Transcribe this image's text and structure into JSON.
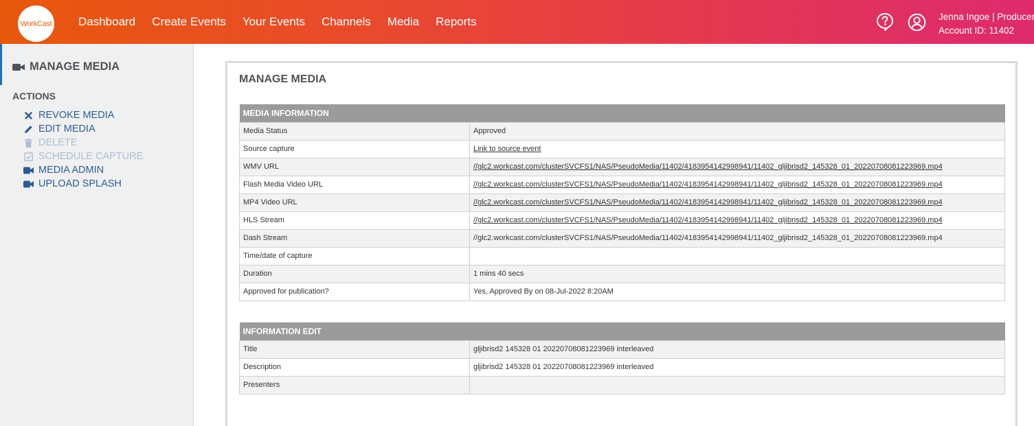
{
  "nav": {
    "logo": "WorkCast",
    "items": [
      "Dashboard",
      "Create Events",
      "Your Events",
      "Channels",
      "Media",
      "Reports"
    ],
    "user_name": "Jenna Ingoe",
    "separator": " | ",
    "user_role": "Producer",
    "account": "Account ID: 11402"
  },
  "sidebar": {
    "title": "MANAGE MEDIA",
    "actions_heading": "ACTIONS",
    "actions": [
      {
        "label": "REVOKE MEDIA",
        "icon": "x-icon",
        "enabled": true
      },
      {
        "label": "EDIT MEDIA",
        "icon": "pencil-icon",
        "enabled": true
      },
      {
        "label": "DELETE",
        "icon": "trash-icon",
        "enabled": false
      },
      {
        "label": "SCHEDULE CAPTURE",
        "icon": "calendar-check-icon",
        "enabled": false
      },
      {
        "label": "MEDIA ADMIN",
        "icon": "video-camera-icon",
        "enabled": true
      },
      {
        "label": "UPLOAD SPLASH",
        "icon": "video-camera-icon",
        "enabled": true
      }
    ]
  },
  "main": {
    "title": "MANAGE MEDIA",
    "media_information": {
      "heading": "MEDIA INFORMATION",
      "rows": [
        {
          "label": "Media Status",
          "value": "Approved",
          "link": false
        },
        {
          "label": "Source capture",
          "value": "Link to source event",
          "link": true
        },
        {
          "label": "WMV URL",
          "value": "//glc2.workcast.com/clusterSVCFS1/NAS/PseudoMedia/11402/4183954142998941/11402_gljibrisd2_145328_01_20220708081223969.mp4",
          "link": true
        },
        {
          "label": "Flash Media Video URL",
          "value": "//glc2.workcast.com/clusterSVCFS1/NAS/PseudoMedia/11402/4183954142998941/11402_gljibrisd2_145328_01_20220708081223969.mp4",
          "link": true
        },
        {
          "label": "MP4 Video URL",
          "value": "//glc2.workcast.com/clusterSVCFS1/NAS/PseudoMedia/11402/4183954142998941/11402_gljibrisd2_145328_01_20220708081223969.mp4",
          "link": true
        },
        {
          "label": "HLS Stream",
          "value": "//glc2.workcast.com/clusterSVCFS1/NAS/PseudoMedia/11402/4183954142998941/11402_gljibrisd2_145328_01_20220708081223969.mp4",
          "link": true
        },
        {
          "label": "Dash Stream",
          "value": "//glc2.workcast.com/clusterSVCFS1/NAS/PseudoMedia/11402/4183954142998941/11402_gljibrisd2_145328_01_20220708081223969.mp4",
          "link": false
        },
        {
          "label": "Time/date of capture",
          "value": "",
          "link": false
        },
        {
          "label": "Duration",
          "value": "1 mins 40 secs",
          "link": false
        },
        {
          "label": "Approved for publication?",
          "value": "Yes, Approved By on 08-Jul-2022 8:20AM",
          "link": false
        }
      ]
    },
    "information_edit": {
      "heading": "INFORMATION EDIT",
      "rows": [
        {
          "label": "Title",
          "value": "gljibrisd2 145328 01 20220708081223969 interleaved",
          "link": false
        },
        {
          "label": "Description",
          "value": "gljibrisd2 145328 01 20220708081223969 interleaved",
          "link": false
        },
        {
          "label": "Presenters",
          "value": "",
          "link": false
        }
      ]
    }
  }
}
